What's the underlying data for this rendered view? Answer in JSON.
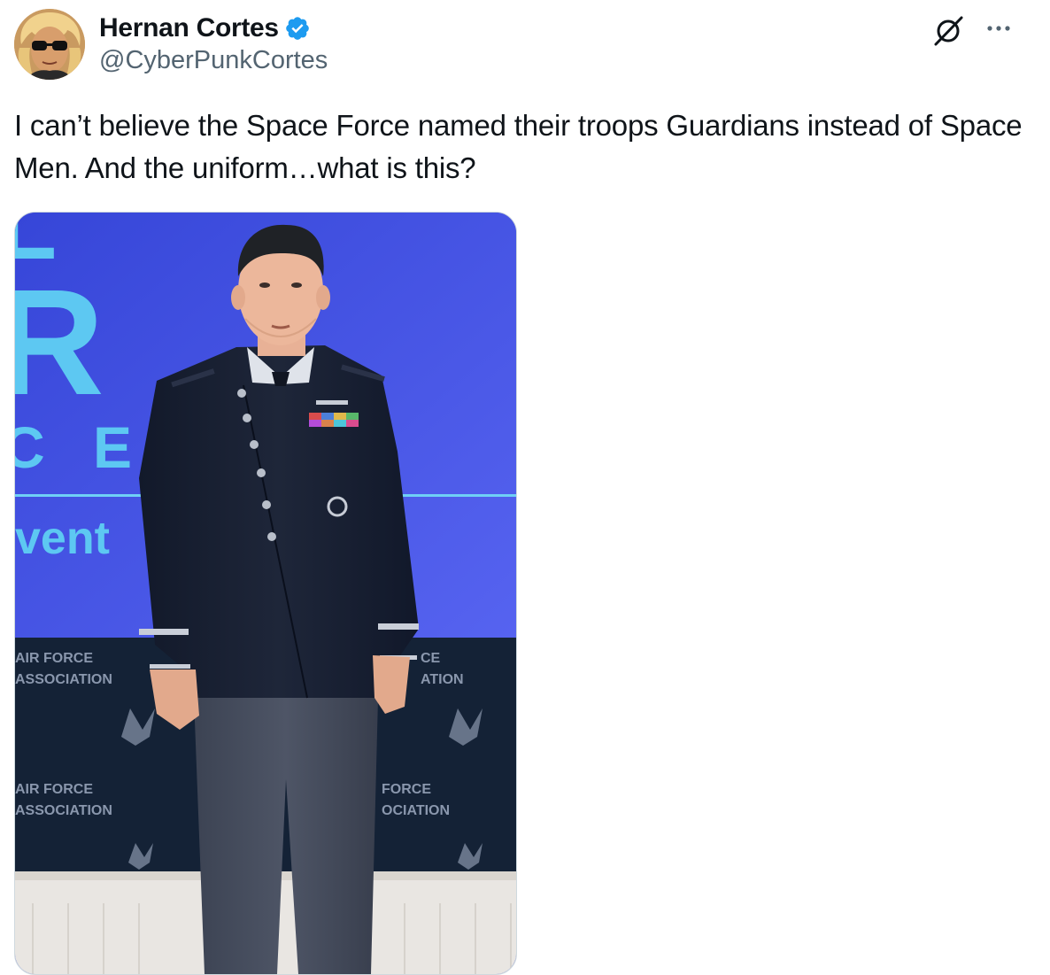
{
  "tweet": {
    "author": {
      "display_name": "Hernan Cortes",
      "handle": "@CyberPunkCortes",
      "verified": true,
      "avatar_icon": "profile-avatar"
    },
    "actions": {
      "grok_icon": "grok-icon",
      "more_icon": "more-options-icon"
    },
    "text": "I can’t believe the Space Force named their troops Guardians instead of Space Men. And the uniform…what is this?",
    "media": {
      "type": "photo",
      "backdrop_texts": {
        "big_letter_1": "L",
        "big_letter_2": "R",
        "spaced_letters": "C E",
        "event_word": "vent",
        "banner_1": "AIR FORCE",
        "banner_2": "ASSOCIATION",
        "banner_right_1": "CE",
        "banner_right_2": "ATION",
        "banner_3": "AIR FORCE",
        "banner_4": "ASSOCIATION",
        "banner_right_3": "FORCE",
        "banner_right_4": "OCIATION"
      }
    }
  },
  "colors": {
    "verified_blue": "#1d9bf0",
    "handle_gray": "#536471",
    "text": "#0f1419",
    "backdrop_blue": "#4350e0",
    "backdrop_light_blue": "#5dc8f2",
    "banner_navy": "#142236",
    "uniform_navy": "#161d2e"
  }
}
